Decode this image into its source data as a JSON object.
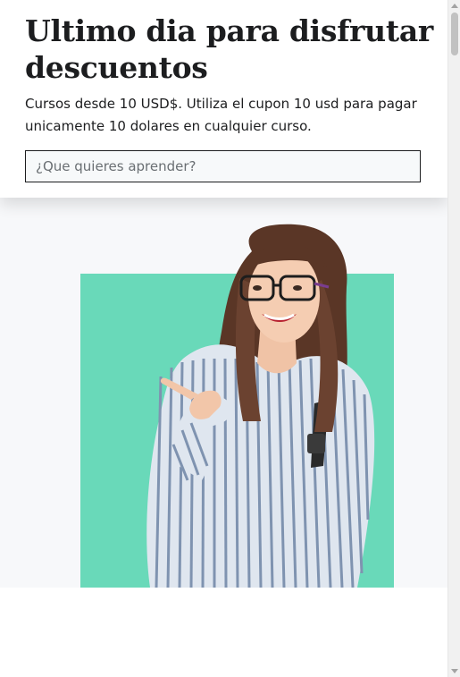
{
  "hero": {
    "title": "Ultimo dia para disfrutar descuentos",
    "subtitle": "Cursos desde 10 USD$. Utiliza el cupon 10 usd para pagar unicamente 10 dolares en cualquier curso.",
    "search_placeholder": "¿Que quieres aprender?"
  },
  "promo_image": {
    "icon": "person-pointing-image"
  },
  "colors": {
    "text": "#1c1d1f",
    "teal": "#69d9b9",
    "section_bg": "#f7f8fa",
    "search_bg": "#f7f9fa"
  }
}
